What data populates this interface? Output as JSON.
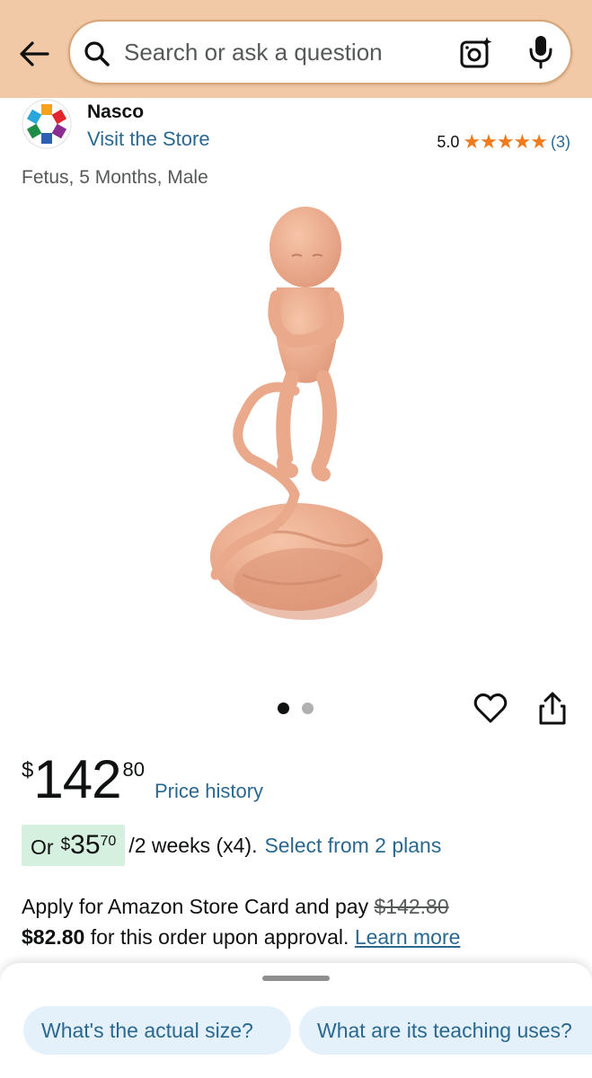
{
  "header": {
    "search_placeholder": "Search or ask a question",
    "back_icon": "back-arrow-icon",
    "camera_icon": "camera-scan-icon",
    "mic_icon": "microphone-icon",
    "bg_color": "#f2c9a6"
  },
  "brand": {
    "name": "Nasco",
    "visit_store": "Visit the Store"
  },
  "rating": {
    "value": "5.0",
    "stars": "★★★★★",
    "count": "(3)",
    "star_color": "#f07a1c"
  },
  "product": {
    "title": "Fetus, 5 Months, Male",
    "image_count": 2,
    "active_image": 1
  },
  "price": {
    "symbol": "$",
    "whole": "142",
    "fraction": "80",
    "history_link": "Price history"
  },
  "installment": {
    "prefix": "Or",
    "symbol": "$",
    "whole": "35",
    "fraction": "70",
    "period": "/2 weeks (x4).",
    "link": "Select from 2 plans"
  },
  "store_card": {
    "line1": "Apply for Amazon Store Card and pay",
    "old_price": "$142.80",
    "new_price": "$82.80",
    "line2": "for this order upon approval.",
    "link": "Learn more"
  },
  "suggestions": [
    "What's the actual size?",
    "What are its teaching uses?"
  ],
  "colors": {
    "link": "#2a6890",
    "chip_bg": "#e4f1fb",
    "installment_bg": "#d6f0df"
  }
}
